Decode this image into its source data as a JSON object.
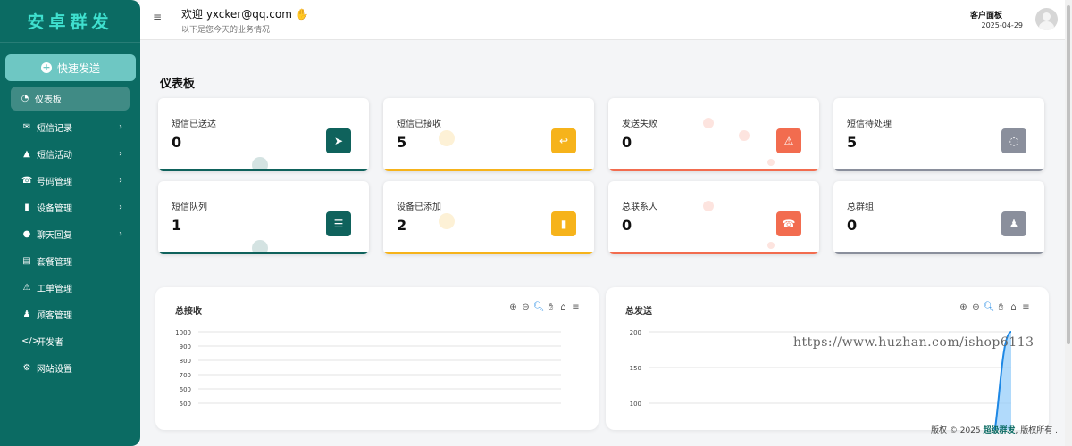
{
  "brand": "安卓群发",
  "quick_send": "快速发送",
  "menu": [
    {
      "label": "仪表板",
      "icon": "dashboard-icon",
      "glyph": "◔",
      "chevron": false
    },
    {
      "label": "短信记录",
      "icon": "envelope-icon",
      "glyph": "✉",
      "chevron": true
    },
    {
      "label": "短信活动",
      "icon": "flask-icon",
      "glyph": "▲",
      "chevron": true
    },
    {
      "label": "号码管理",
      "icon": "phone-icon",
      "glyph": "☎",
      "chevron": true
    },
    {
      "label": "设备管理",
      "icon": "mobile-icon",
      "glyph": "▮",
      "chevron": true
    },
    {
      "label": "聊天回复",
      "icon": "chat-icon",
      "glyph": "●",
      "chevron": true
    },
    {
      "label": "套餐管理",
      "icon": "file-icon",
      "glyph": "▤",
      "chevron": false
    },
    {
      "label": "工单管理",
      "icon": "warning-icon",
      "glyph": "⚠",
      "chevron": false
    },
    {
      "label": "顾客管理",
      "icon": "user-plus-icon",
      "glyph": "♟",
      "chevron": false
    },
    {
      "label": "开发者",
      "icon": "code-icon",
      "glyph": "</>",
      "chevron": false
    },
    {
      "label": "网站设置",
      "icon": "gear-icon",
      "glyph": "⚙",
      "chevron": false
    }
  ],
  "header": {
    "welcome": "欢迎 yxcker@qq.com",
    "subtitle": "以下是您今天的业务情况",
    "panel_title": "客户面板",
    "date": "2025-04-29"
  },
  "page_heading": "仪表板",
  "cards": [
    {
      "label": "短信已送达",
      "value": "0",
      "icon": "send-icon",
      "glyph": "➤",
      "color": "#0f625c"
    },
    {
      "label": "短信已接收",
      "value": "5",
      "icon": "reply-icon",
      "glyph": "↩",
      "color": "#f6b31b"
    },
    {
      "label": "发送失败",
      "value": "0",
      "icon": "alert-icon",
      "glyph": "⚠",
      "color": "#f26c4f"
    },
    {
      "label": "短信待处理",
      "value": "5",
      "icon": "spinner-icon",
      "glyph": "◌",
      "color": "#8a8f9c"
    },
    {
      "label": "短信队列",
      "value": "1",
      "icon": "list-icon",
      "glyph": "☰",
      "color": "#0f625c"
    },
    {
      "label": "设备已添加",
      "value": "2",
      "icon": "mobile-icon",
      "glyph": "▮",
      "color": "#f6b31b"
    },
    {
      "label": "总联系人",
      "value": "0",
      "icon": "phone-icon",
      "glyph": "☎",
      "color": "#f26c4f"
    },
    {
      "label": "总群组",
      "value": "0",
      "icon": "users-icon",
      "glyph": "♟",
      "color": "#8a8f9c"
    }
  ],
  "chart_data": [
    {
      "type": "line",
      "title": "总接收",
      "yticks": [
        "1000",
        "900",
        "800",
        "700",
        "600",
        "500"
      ],
      "ylim": [
        500,
        1000
      ],
      "series": []
    },
    {
      "type": "area",
      "title": "总发送",
      "yticks": [
        "200",
        "150",
        "100"
      ],
      "ylim": [
        100,
        200
      ],
      "series": [
        {
          "values": [
            0,
            0,
            0,
            0,
            0,
            0,
            0,
            0,
            0,
            0,
            0,
            0,
            0,
            0,
            5,
            200
          ]
        }
      ]
    }
  ],
  "footer": {
    "prefix": "版权 © 2025 ",
    "brand": "超级群发",
    "suffix": ", 版权所有 ."
  },
  "watermark": "https://www.huzhan.com/ishop6113"
}
